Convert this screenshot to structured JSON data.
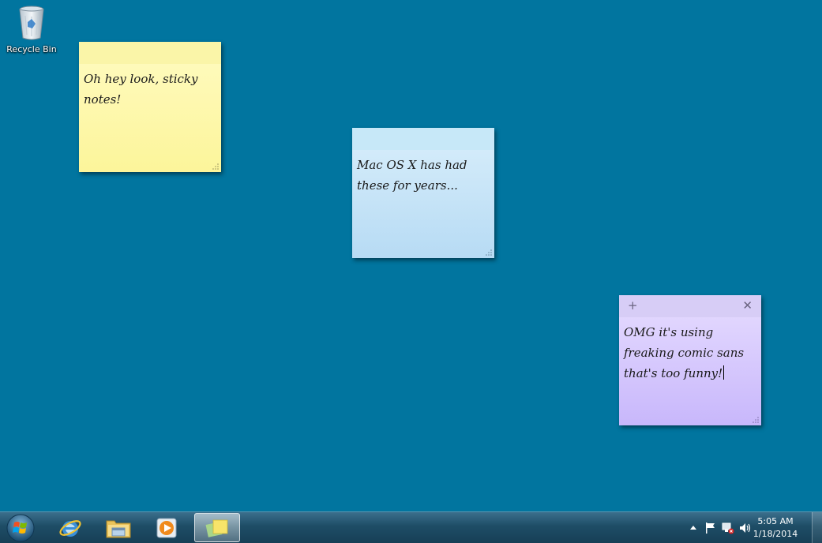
{
  "desktop": {
    "background": "#01759f",
    "icons": [
      {
        "label": "Recycle Bin",
        "icon": "recycle-bin-icon"
      }
    ]
  },
  "notes": [
    {
      "color": "#fcf59a",
      "text": "Oh hey look, sticky\nnotes!"
    },
    {
      "color": "#b7dbf4",
      "text": "Mac OS X has had\nthese for years..."
    },
    {
      "color": "#c8b7fb",
      "text": "OMG it's using\nfreaking comic sans\nthat's too funny!",
      "header": {
        "add": "+",
        "close": "✕"
      }
    }
  ],
  "taskbar": {
    "start": "start-orb-icon",
    "pinned": [
      {
        "name": "internet-explorer-icon"
      },
      {
        "name": "windows-explorer-icon"
      },
      {
        "name": "media-player-icon"
      },
      {
        "name": "sticky-notes-icon",
        "active": true
      }
    ],
    "tray": {
      "icons": [
        "show-hidden-icons-arrow",
        "action-center-flag-icon",
        "network-icon",
        "volume-icon"
      ],
      "time": "5:05 AM",
      "date": "1/18/2014"
    }
  }
}
